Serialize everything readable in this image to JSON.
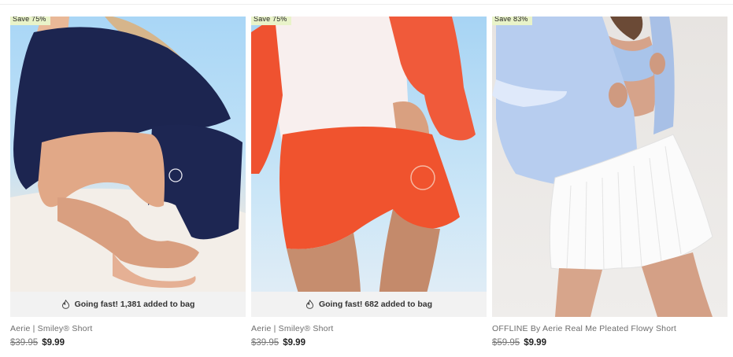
{
  "products": [
    {
      "badge": "Save 75%",
      "fast_text": "Going fast! 1,381 added to bag",
      "name": "Aerie | Smiley® Short",
      "old_price": "$39.95",
      "new_price": "$9.99",
      "image": "navy-shorts-photo"
    },
    {
      "badge": "Save 75%",
      "fast_text": "Going fast! 682 added to bag",
      "name": "Aerie | Smiley® Short",
      "old_price": "$39.95",
      "new_price": "$9.99",
      "image": "orange-shorts-photo"
    },
    {
      "badge": "Save 83%",
      "fast_text": "",
      "name": "OFFLINE By Aerie Real Me Pleated Flowy Short",
      "old_price": "$59.95",
      "new_price": "$9.99",
      "image": "white-pleated-skirt-photo"
    }
  ],
  "colors": {
    "badge_bg": "#e9f3c9",
    "strip_bg": "#f2f2f2",
    "navy": "#1c2550",
    "orange": "#f0532e",
    "light_blue": "#b7cdef"
  },
  "icons": {
    "going_fast": "fire-icon"
  }
}
